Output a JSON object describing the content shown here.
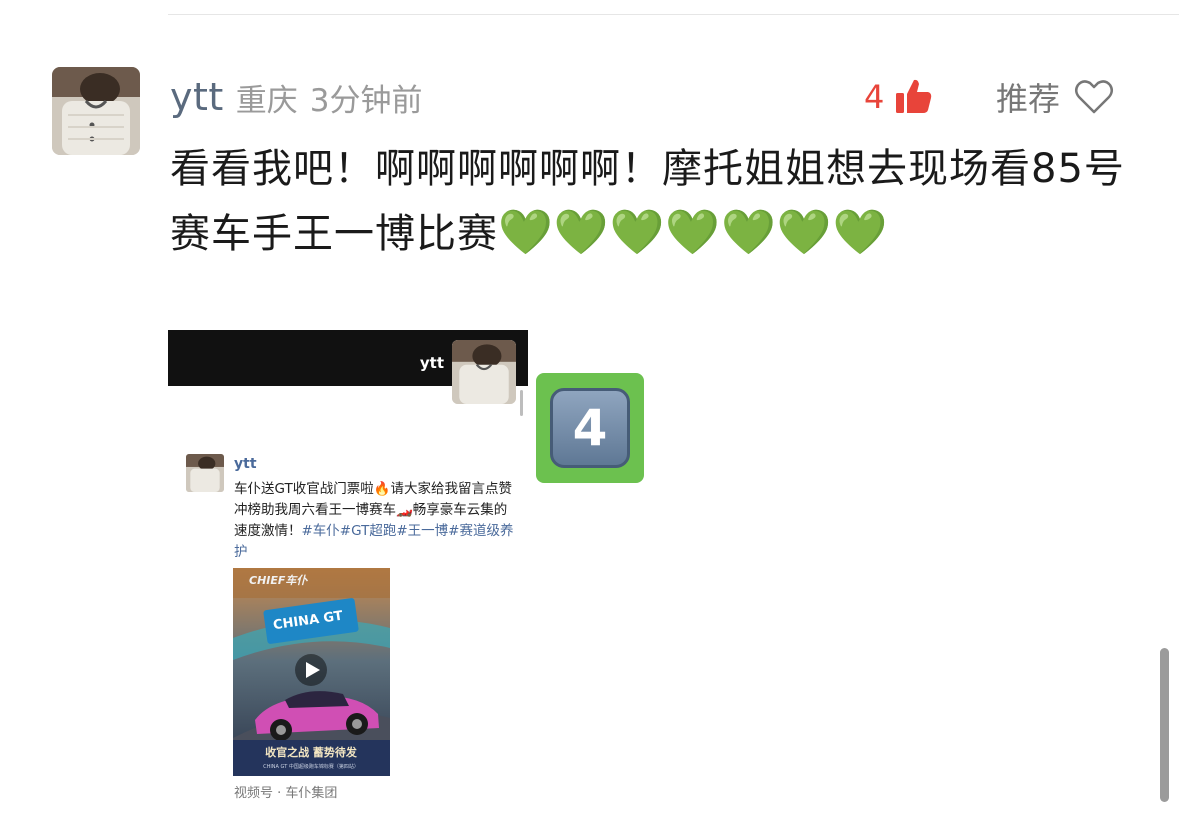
{
  "comment": {
    "username": "ytt",
    "location": "重庆",
    "time_ago": "3分钟前",
    "like_count": "4",
    "recommend_label": "推荐",
    "text": "看看我吧！啊啊啊啊啊啊！摩托姐姐想去现场看85号赛车手王一博比赛",
    "emoji": "💚💚💚💚💚💚💚"
  },
  "attachment": {
    "header_username": "ytt",
    "post": {
      "username": "ytt",
      "text": "车仆送GT收官战门票啦🔥请大家给我留言点赞冲榜助我周六看王一博赛车🏎️畅享豪车云集的速度激情！",
      "tags": "#车仆#GT超跑#王一博#赛道级养护",
      "video_brand": "CHIEF车仆",
      "video_event": "CHINA GT",
      "video_slogan": "收官之战 蓄势待发",
      "video_caption": "CHINA GT 中国超级跑车锦标赛（第四站）",
      "video_source": "视频号 · 车仆集团"
    }
  },
  "badge": {
    "label": "4"
  },
  "colors": {
    "username": "#5a6a7e",
    "like": "#e8443a",
    "heart_emoji": "#2fbe3a",
    "badge_bg": "#6cc14f"
  },
  "icons": {
    "like": "thumbs-up-icon",
    "recommend": "heart-outline-icon"
  }
}
